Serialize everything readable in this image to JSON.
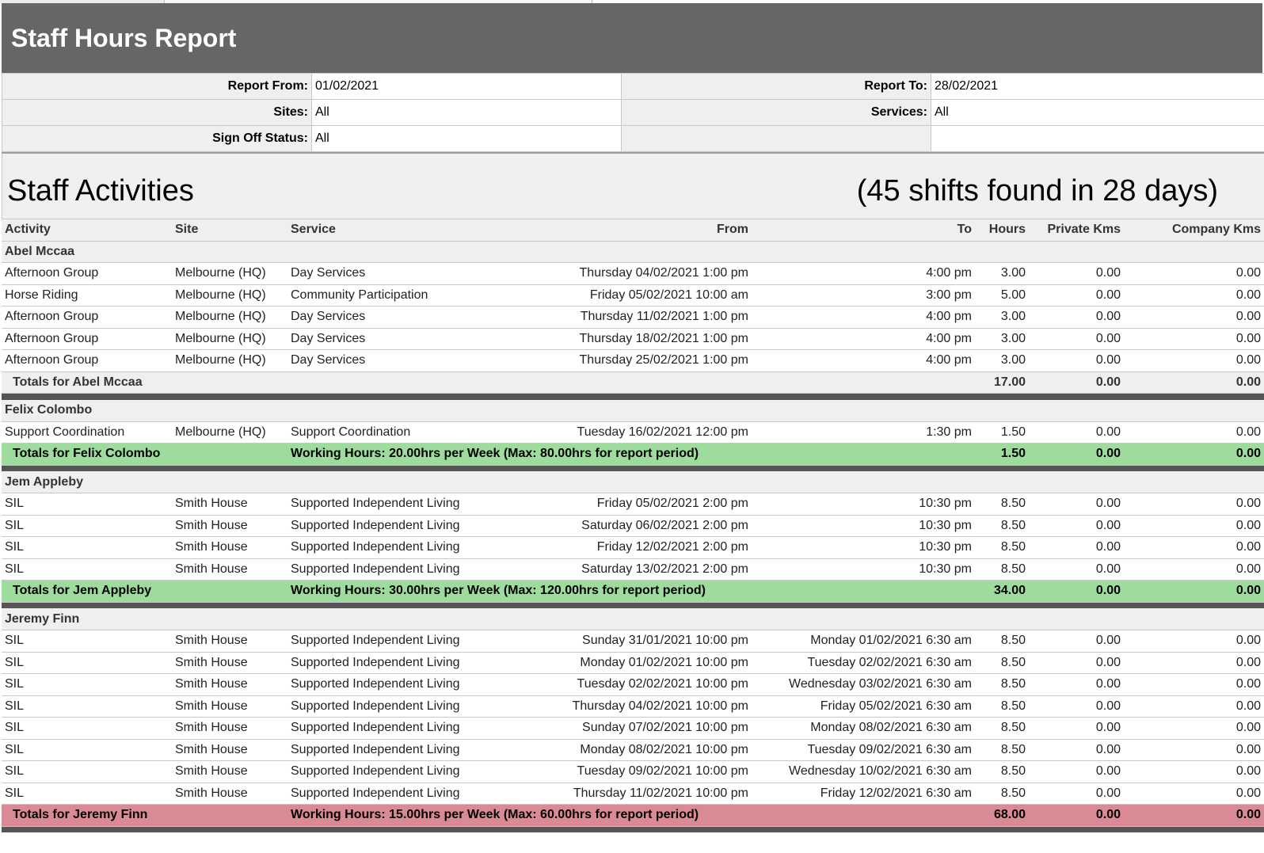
{
  "report": {
    "title": "Staff Hours Report",
    "params": {
      "report_from_label": "Report From:",
      "report_from": "01/02/2021",
      "report_to_label": "Report To:",
      "report_to": "28/02/2021",
      "sites_label": "Sites:",
      "sites": "All",
      "services_label": "Services:",
      "services": "All",
      "sign_off_label": "Sign Off Status:",
      "sign_off": "All"
    }
  },
  "section": {
    "title": "Staff Activities",
    "count_text": "(45 shifts found in 28 days)"
  },
  "columns": [
    "Activity",
    "Site",
    "Service",
    "From",
    "To",
    "Hours",
    "Private Kms",
    "Company Kms"
  ],
  "staff": [
    {
      "name": "Abel Mccaa",
      "rows": [
        [
          "Afternoon Group",
          "Melbourne (HQ)",
          "Day Services",
          "Thursday 04/02/2021 1:00 pm",
          "4:00 pm",
          "3.00",
          "0.00",
          "0.00"
        ],
        [
          "Horse Riding",
          "Melbourne (HQ)",
          "Community Participation",
          "Friday 05/02/2021 10:00 am",
          "3:00 pm",
          "5.00",
          "0.00",
          "0.00"
        ],
        [
          "Afternoon Group",
          "Melbourne (HQ)",
          "Day Services",
          "Thursday 11/02/2021 1:00 pm",
          "4:00 pm",
          "3.00",
          "0.00",
          "0.00"
        ],
        [
          "Afternoon Group",
          "Melbourne (HQ)",
          "Day Services",
          "Thursday 18/02/2021 1:00 pm",
          "4:00 pm",
          "3.00",
          "0.00",
          "0.00"
        ],
        [
          "Afternoon Group",
          "Melbourne (HQ)",
          "Day Services",
          "Thursday 25/02/2021 1:00 pm",
          "4:00 pm",
          "3.00",
          "0.00",
          "0.00"
        ]
      ],
      "total_label": "Totals for Abel Mccaa",
      "working_hours": "",
      "total_hours": "17.00",
      "total_private": "0.00",
      "total_company": "0.00",
      "status": "neutral",
      "status_color": "#efefef"
    },
    {
      "name": "Felix Colombo",
      "rows": [
        [
          "Support Coordination",
          "Melbourne (HQ)",
          "Support Coordination",
          "Tuesday 16/02/2021 12:00 pm",
          "1:30 pm",
          "1.50",
          "0.00",
          "0.00"
        ]
      ],
      "total_label": "Totals for Felix Colombo",
      "working_hours": "Working Hours: 20.00hrs per Week  (Max: 80.00hrs for report period)",
      "total_hours": "1.50",
      "total_private": "0.00",
      "total_company": "0.00",
      "status": "green",
      "status_color": "#9ddc9c"
    },
    {
      "name": "Jem Appleby",
      "rows": [
        [
          "SIL",
          "Smith House",
          "Supported Independent Living (SIL)",
          "Friday 05/02/2021 2:00 pm",
          "10:30 pm",
          "8.50",
          "0.00",
          "0.00"
        ],
        [
          "SIL",
          "Smith House",
          "Supported Independent Living (SIL)",
          "Saturday 06/02/2021 2:00 pm",
          "10:30 pm",
          "8.50",
          "0.00",
          "0.00"
        ],
        [
          "SIL",
          "Smith House",
          "Supported Independent Living (SIL)",
          "Friday 12/02/2021 2:00 pm",
          "10:30 pm",
          "8.50",
          "0.00",
          "0.00"
        ],
        [
          "SIL",
          "Smith House",
          "Supported Independent Living (SIL)",
          "Saturday 13/02/2021 2:00 pm",
          "10:30 pm",
          "8.50",
          "0.00",
          "0.00"
        ]
      ],
      "total_label": "Totals for Jem Appleby",
      "working_hours": "Working Hours: 30.00hrs per Week  (Max: 120.00hrs for report period)",
      "total_hours": "34.00",
      "total_private": "0.00",
      "total_company": "0.00",
      "status": "green",
      "status_color": "#9ddc9c"
    },
    {
      "name": "Jeremy Finn",
      "rows": [
        [
          "SIL",
          "Smith House",
          "Supported Independent Living (SIL)",
          "Sunday 31/01/2021 10:00 pm",
          "Monday 01/02/2021 6:30 am",
          "8.50",
          "0.00",
          "0.00"
        ],
        [
          "SIL",
          "Smith House",
          "Supported Independent Living (SIL)",
          "Monday 01/02/2021 10:00 pm",
          "Tuesday 02/02/2021 6:30 am",
          "8.50",
          "0.00",
          "0.00"
        ],
        [
          "SIL",
          "Smith House",
          "Supported Independent Living (SIL)",
          "Tuesday 02/02/2021 10:00 pm",
          "Wednesday 03/02/2021 6:30 am",
          "8.50",
          "0.00",
          "0.00"
        ],
        [
          "SIL",
          "Smith House",
          "Supported Independent Living (SIL)",
          "Thursday 04/02/2021 10:00 pm",
          "Friday 05/02/2021 6:30 am",
          "8.50",
          "0.00",
          "0.00"
        ],
        [
          "SIL",
          "Smith House",
          "Supported Independent Living (SIL)",
          "Sunday 07/02/2021 10:00 pm",
          "Monday 08/02/2021 6:30 am",
          "8.50",
          "0.00",
          "0.00"
        ],
        [
          "SIL",
          "Smith House",
          "Supported Independent Living (SIL)",
          "Monday 08/02/2021 10:00 pm",
          "Tuesday 09/02/2021 6:30 am",
          "8.50",
          "0.00",
          "0.00"
        ],
        [
          "SIL",
          "Smith House",
          "Supported Independent Living (SIL)",
          "Tuesday 09/02/2021 10:00 pm",
          "Wednesday 10/02/2021 6:30 am",
          "8.50",
          "0.00",
          "0.00"
        ],
        [
          "SIL",
          "Smith House",
          "Supported Independent Living (SIL)",
          "Thursday 11/02/2021 10:00 pm",
          "Friday 12/02/2021 6:30 am",
          "8.50",
          "0.00",
          "0.00"
        ]
      ],
      "total_label": "Totals for Jeremy Finn",
      "working_hours": "Working Hours: 15.00hrs per Week  (Max: 60.00hrs for report period)",
      "total_hours": "68.00",
      "total_private": "0.00",
      "total_company": "0.00",
      "status": "red",
      "status_color": "#da8a94"
    }
  ]
}
